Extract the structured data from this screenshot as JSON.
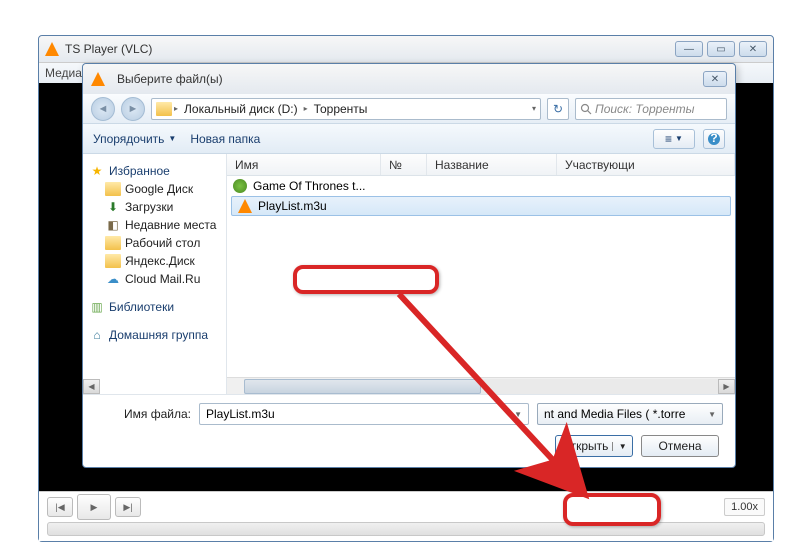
{
  "vlc": {
    "title": "TS Player (VLC)",
    "menu_media": "Медиа",
    "speed": "1.00x"
  },
  "dialog": {
    "title": "Выберите файл(ы)",
    "breadcrumb": {
      "level1": "Локальный диск (D:)",
      "level2": "Торренты"
    },
    "search_placeholder": "Поиск: Торренты",
    "toolbar": {
      "organize": "Упорядочить",
      "new_folder": "Новая папка"
    },
    "tree": {
      "favorites": "Избранное",
      "google_disk": "Google Диск",
      "downloads": "Загрузки",
      "recent": "Недавние места",
      "desktop": "Рабочий стол",
      "yandex": "Яндекс.Диск",
      "cloud_mail": "Cloud Mail.Ru",
      "libraries": "Библиотеки",
      "homegroup": "Домашняя группа"
    },
    "columns": {
      "name": "Имя",
      "num": "№",
      "title": "Название",
      "participants": "Участвующи"
    },
    "files": [
      {
        "name": "Game Of Thrones t...",
        "type": "torrent"
      },
      {
        "name": "PlayList.m3u",
        "type": "vlc",
        "selected": true
      }
    ],
    "filename_label": "Имя файла:",
    "filename_value": "PlayList.m3u",
    "filter_text": "nt and Media Files ( *.torre",
    "open_btn": "Открыть",
    "cancel_btn": "Отмена"
  }
}
